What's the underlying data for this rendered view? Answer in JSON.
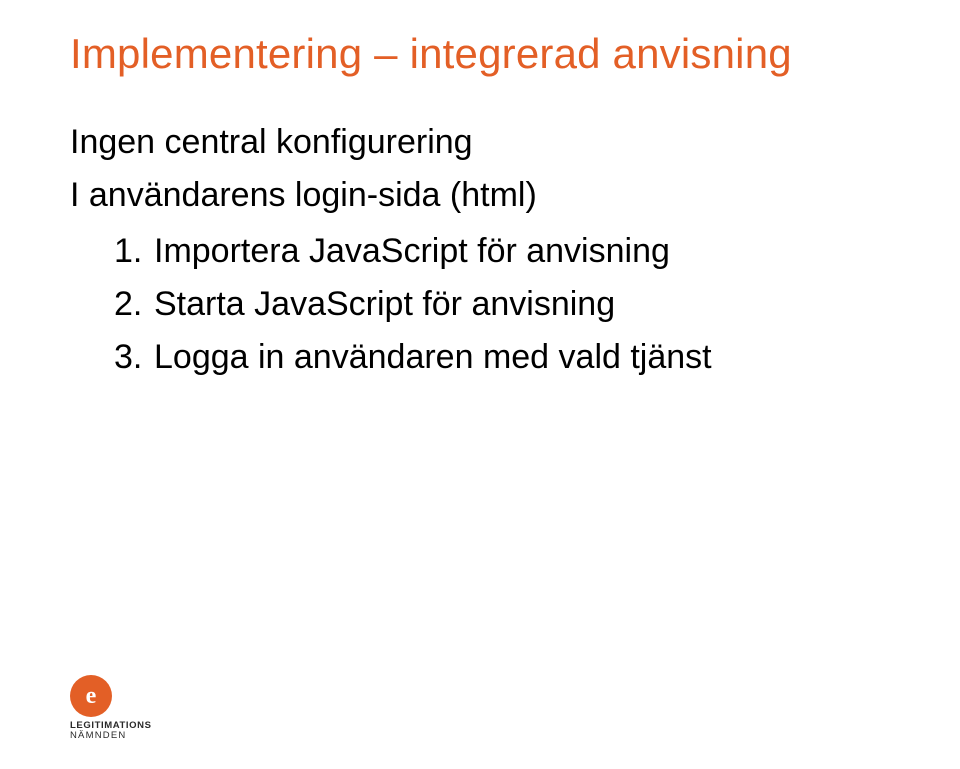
{
  "title": "Implementering – integrerad anvisning",
  "body": {
    "line1": "Ingen central konfigurering",
    "line2": "I användarens login-sida (html)",
    "items": [
      {
        "num": "1.",
        "text": "Importera JavaScript för anvisning"
      },
      {
        "num": "2.",
        "text": "Starta JavaScript för anvisning"
      },
      {
        "num": "3.",
        "text": "Logga in användaren med vald tjänst"
      }
    ]
  },
  "logo": {
    "letter": "e",
    "word1": "LEGITIMATIONS",
    "word2": "NÄMNDEN"
  }
}
